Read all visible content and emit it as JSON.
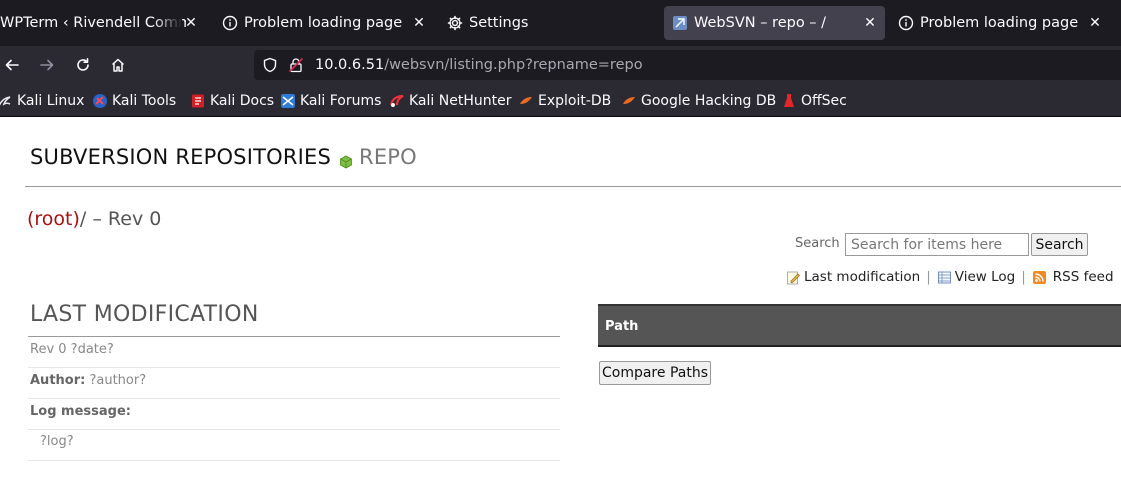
{
  "browser": {
    "tabs": [
      {
        "title": "WPTerm ‹ Rivendell Commun",
        "icon": "none",
        "active": false,
        "closable": true
      },
      {
        "title": "Problem loading page",
        "icon": "info-icon",
        "active": false,
        "closable": true
      },
      {
        "title": "Settings",
        "icon": "gear-icon",
        "active": false,
        "closable": false
      },
      {
        "title": "WebSVN – repo – /",
        "icon": "websvn-icon",
        "active": true,
        "closable": true
      },
      {
        "title": "Problem loading page",
        "icon": "info-icon",
        "active": false,
        "closable": true
      }
    ],
    "url_host": "10.0.6.51",
    "url_path": "/websvn/listing.php?repname=repo",
    "bookmarks": [
      {
        "label": "Kali Linux",
        "icon": "kali-dragon-icon"
      },
      {
        "label": "Kali Tools",
        "icon": "kali-tools-icon"
      },
      {
        "label": "Kali Docs",
        "icon": "kali-docs-icon"
      },
      {
        "label": "Kali Forums",
        "icon": "kali-forums-icon"
      },
      {
        "label": "Kali NetHunter",
        "icon": "nethunter-icon"
      },
      {
        "label": "Exploit-DB",
        "icon": "exploit-db-icon"
      },
      {
        "label": "Google Hacking DB",
        "icon": "ghdb-icon"
      },
      {
        "label": "OffSec",
        "icon": "offsec-icon"
      }
    ]
  },
  "page": {
    "site_title": "SUBVERSION REPOSITORIES",
    "repo_name": "REPO",
    "breadcrumb_root": "(root)",
    "breadcrumb_rest": "/ – Rev 0",
    "search": {
      "label": "Search",
      "placeholder": "Search for items here",
      "button": "Search"
    },
    "actions": {
      "last_modification": "Last modification",
      "view_log": "View Log",
      "rss_feed": "RSS feed",
      "separator": "|"
    },
    "last_modification": {
      "heading": "LAST MODIFICATION",
      "rev_line": "Rev 0 ?date?",
      "author_label": "Author:",
      "author_value": "?author?",
      "log_label": "Log message:",
      "log_value": "?log?"
    },
    "path_header": "Path",
    "compare_button": "Compare Paths"
  },
  "colors": {
    "tabbar_bg": "#1c1b22",
    "toolbar_bg": "#2b2a33",
    "breadcrumb_root": "#aa1111",
    "path_header_bg": "#555555"
  }
}
